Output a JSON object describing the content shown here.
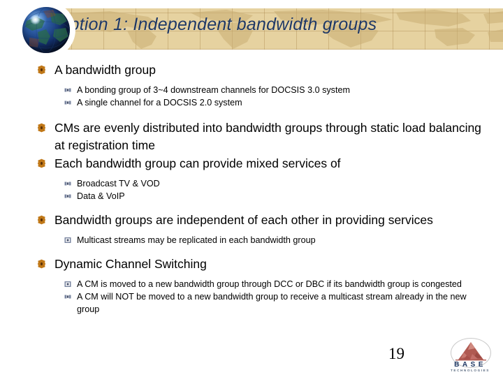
{
  "slide": {
    "title": "Option 1: Independent bandwidth groups",
    "page_number": "19",
    "title_color": "#1f3864",
    "banner_color": "#e6d2a0",
    "bullet1_color": "#c07818",
    "bullet2_color": "#7a86a0"
  },
  "icons": {
    "globe": "globe-icon",
    "bullet_level1": "gear-bullet-icon",
    "bullet_level2": "square-bullet-icon",
    "logo_mountain": "mountain-logo-icon"
  },
  "body": [
    {
      "level": 1,
      "text": "A bandwidth group"
    },
    {
      "level": 2,
      "text": "A bonding group of 3~4 downstream channels for DOCSIS 3.0 system"
    },
    {
      "level": 2,
      "text": "A single channel for a DOCSIS 2.0 system"
    },
    {
      "level": 1,
      "text": "CMs are evenly distributed into bandwidth groups through static load balancing at registration time"
    },
    {
      "level": 1,
      "text": "Each bandwidth group can provide mixed services of"
    },
    {
      "level": 2,
      "text": "Broadcast TV & VOD"
    },
    {
      "level": 2,
      "text": "Data & VoIP"
    },
    {
      "level": 1,
      "text": "Bandwidth groups are independent of each other in providing services"
    },
    {
      "level": 2,
      "text": "Multicast streams may be replicated in each bandwidth group"
    },
    {
      "level": 1,
      "text": "Dynamic Channel Switching"
    },
    {
      "level": 2,
      "text": "A CM is moved to a new bandwidth group through DCC or DBC if its bandwidth group is congested"
    },
    {
      "level": 2,
      "text": "A CM will NOT be moved to a new bandwidth group to receive a multicast stream already in the new group"
    }
  ],
  "logo": {
    "name": "BASE",
    "tagline": "TECHNOLOGIES"
  }
}
